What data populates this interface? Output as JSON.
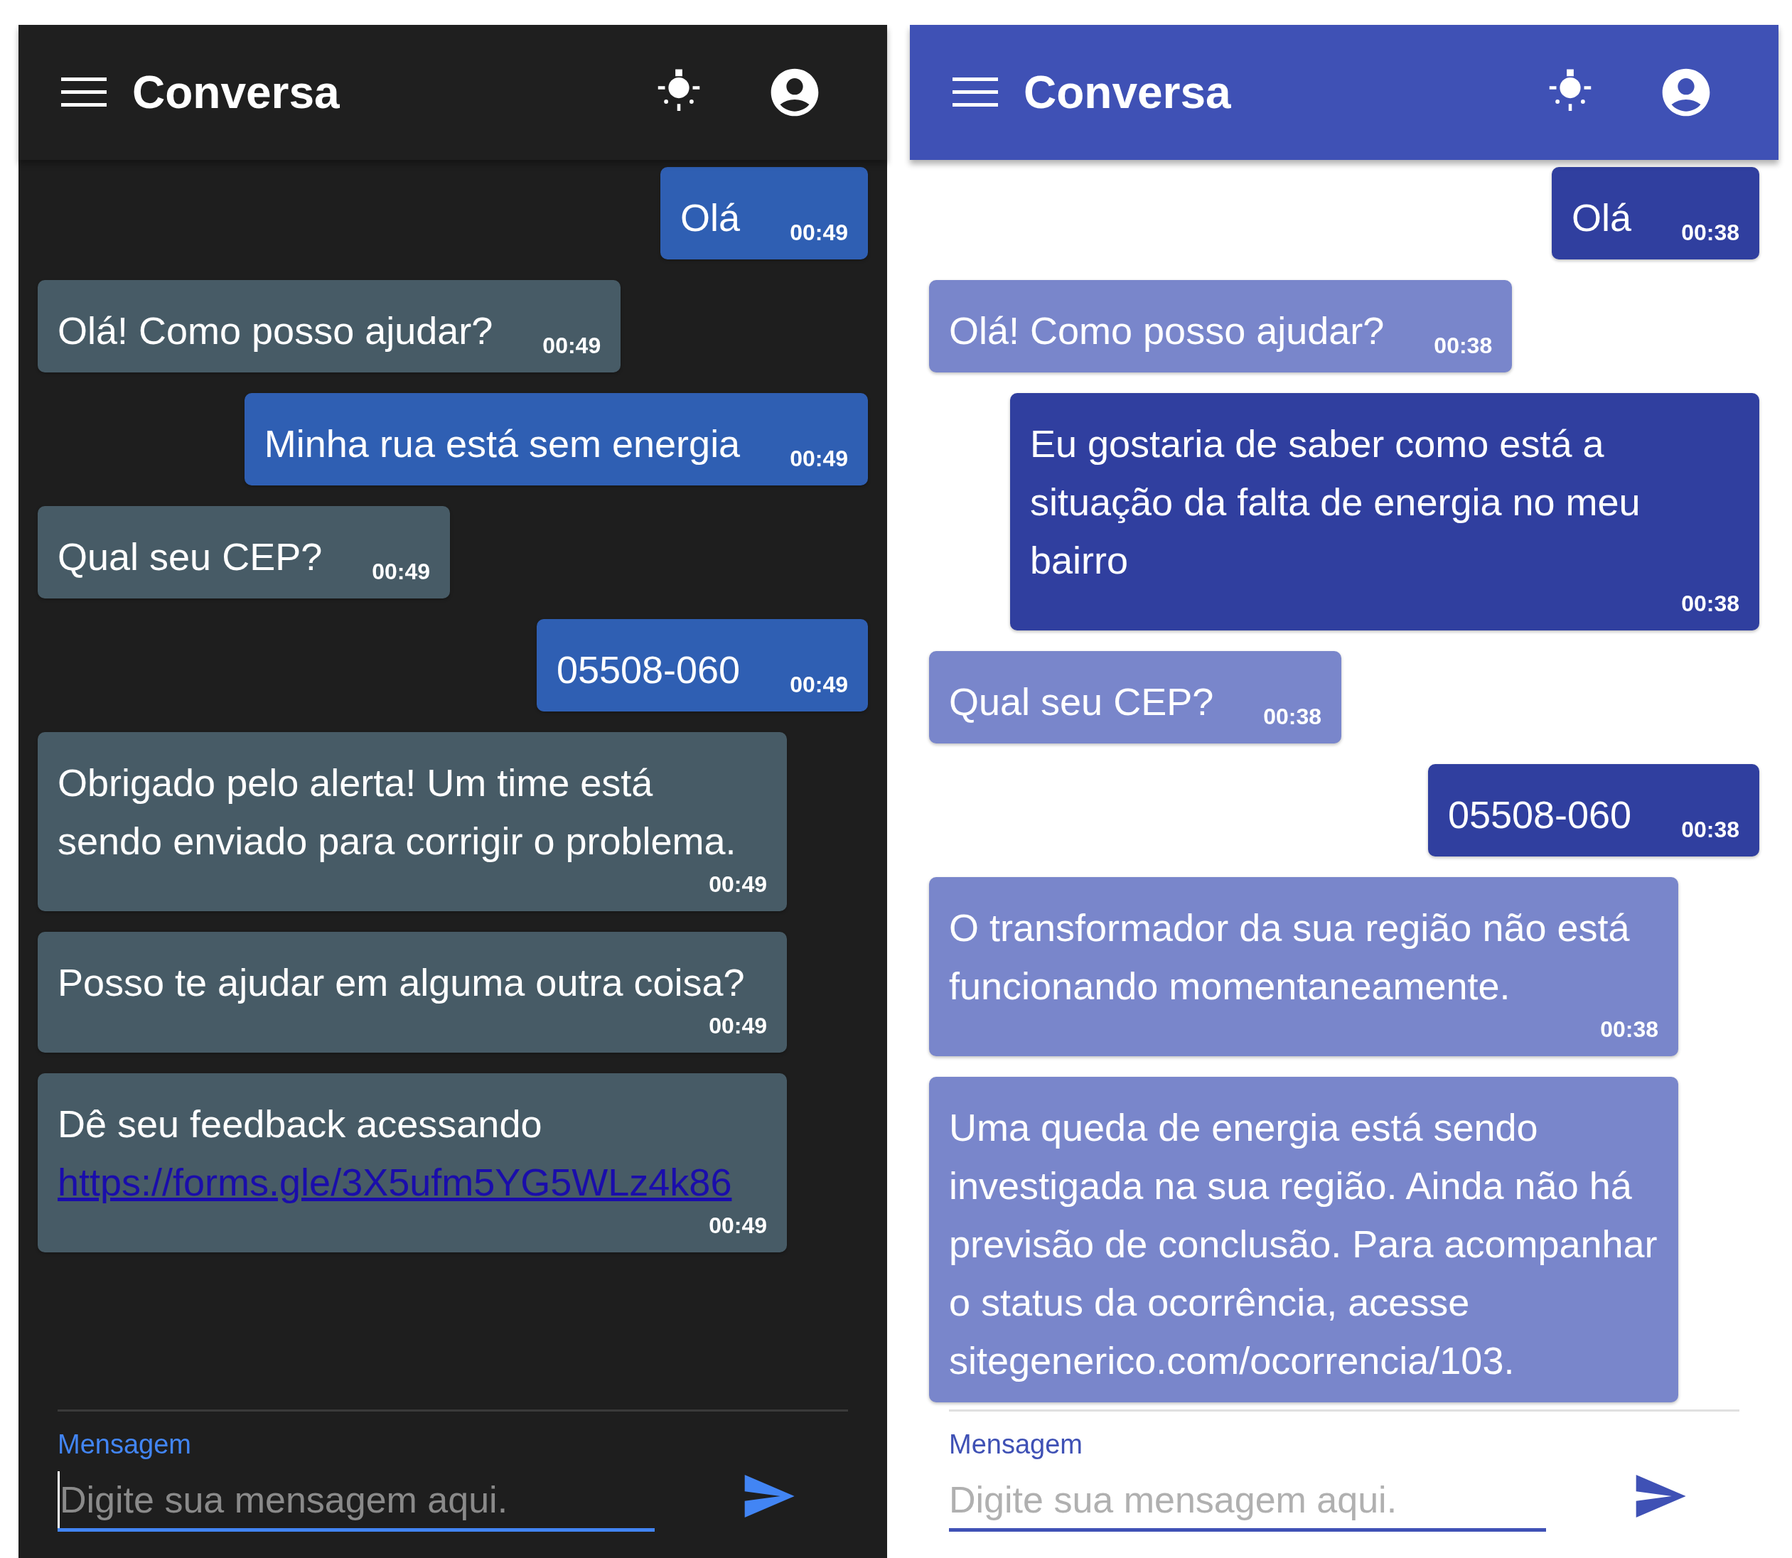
{
  "panels": [
    {
      "kind": "dark",
      "header": {
        "title": "Conversa"
      },
      "messages": [
        {
          "kind": "user",
          "text": "Olá",
          "time": "00:49"
        },
        {
          "kind": "bot",
          "text": "Olá! Como posso ajudar?",
          "time": "00:49"
        },
        {
          "kind": "user",
          "text": "Minha rua está sem energia",
          "time": "00:49"
        },
        {
          "kind": "bot",
          "text": "Qual seu CEP?",
          "time": "00:49"
        },
        {
          "kind": "user",
          "text": "05508-060",
          "time": "00:49"
        },
        {
          "kind": "bot",
          "text": "Obrigado pelo alerta! Um time está sendo enviado para corrigir o problema.",
          "time": "00:49"
        },
        {
          "kind": "bot",
          "text": "Posso te ajudar em alguma outra coisa?",
          "time": "00:49"
        },
        {
          "kind": "bot",
          "text": "Dê seu feedback acessando",
          "link": "https://forms.gle/3X5ufm5YG5WLz4k86",
          "time": "00:49"
        }
      ],
      "input": {
        "label": "Mensagem",
        "placeholder": "Digite sua mensagem aqui.",
        "focused": true
      }
    },
    {
      "kind": "light",
      "header": {
        "title": "Conversa"
      },
      "messages": [
        {
          "kind": "user",
          "text": "Olá",
          "time": "00:38"
        },
        {
          "kind": "bot",
          "text": "Olá! Como posso ajudar?",
          "time": "00:38"
        },
        {
          "kind": "user",
          "text": "Eu gostaria de saber como está a situação da falta de energia no meu bairro",
          "time": "00:38"
        },
        {
          "kind": "bot",
          "text": "Qual seu CEP?",
          "time": "00:38"
        },
        {
          "kind": "user",
          "text": "05508-060",
          "time": "00:38"
        },
        {
          "kind": "bot",
          "text": "O transformador da sua região não está funcionando momentaneamente.",
          "time": "00:38"
        },
        {
          "kind": "bot",
          "text": "Uma queda de energia está sendo investigada na sua região. Ainda não há previsão de conclusão. Para acompanhar o status da ocorrência, acesse sitegenerico.com/ocorrencia/103."
        }
      ],
      "input": {
        "label": "Mensagem",
        "placeholder": "Digite sua mensagem aqui.",
        "focused": false
      }
    }
  ]
}
